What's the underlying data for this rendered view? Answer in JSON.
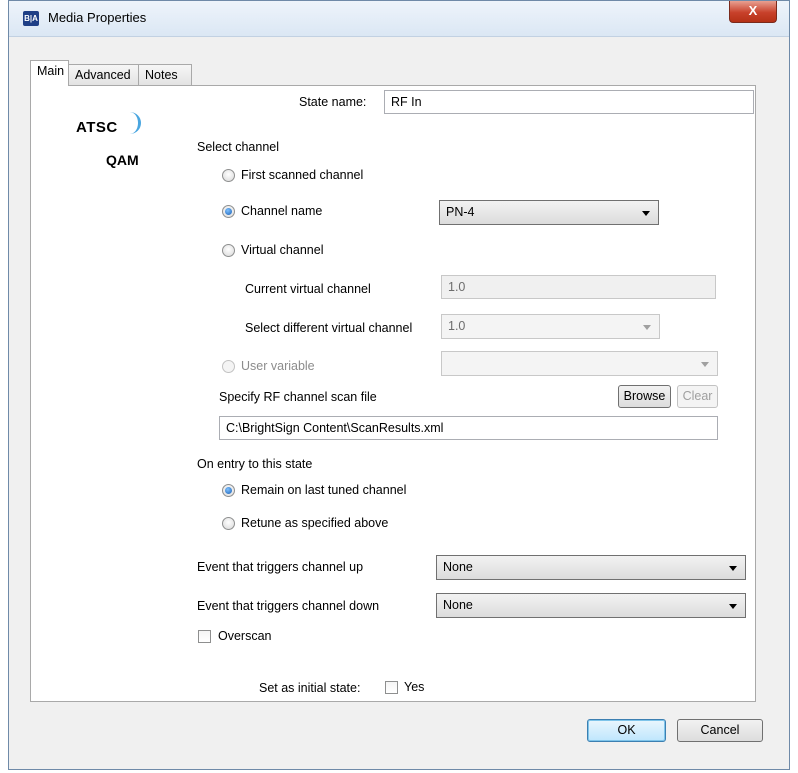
{
  "window": {
    "title": "Media Properties",
    "app_icon_text": "B|A",
    "close_symbol": "X"
  },
  "tabs": [
    {
      "label": "Main"
    },
    {
      "label": "Advanced"
    },
    {
      "label": "Notes"
    }
  ],
  "logo": {
    "line1": "ATSC",
    "line2": "QAM"
  },
  "state_name": {
    "label": "State name:",
    "value": "RF In"
  },
  "select_channel": {
    "label": "Select channel",
    "first_scanned": "First scanned channel",
    "channel_name": "Channel name",
    "channel_name_value": "PN-4",
    "virtual_channel": "Virtual channel",
    "current_virtual_label": "Current virtual channel",
    "current_virtual_value": "1.0",
    "select_virtual_label": "Select different virtual channel",
    "select_virtual_value": "1.0",
    "user_variable": "User variable",
    "user_variable_value": "",
    "scan_file_label": "Specify RF channel scan file",
    "browse": "Browse",
    "clear": "Clear",
    "scan_file_path": "C:\\BrightSign Content\\ScanResults.xml"
  },
  "on_entry": {
    "label": "On entry to this state",
    "remain": "Remain on last tuned channel",
    "retune": "Retune as specified above"
  },
  "events": {
    "up_label": "Event that triggers channel up",
    "up_value": "None",
    "down_label": "Event that triggers channel down",
    "down_value": "None"
  },
  "overscan": "Overscan",
  "initial_state": {
    "label": "Set as initial state:",
    "yes": "Yes"
  },
  "buttons": {
    "ok": "OK",
    "cancel": "Cancel"
  }
}
